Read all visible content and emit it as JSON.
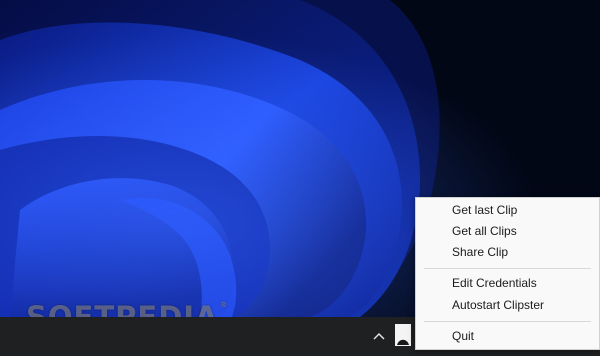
{
  "watermark": {
    "text": "SOFTPEDIA",
    "mark": "®"
  },
  "taskbar": {
    "overflow_icon": "chevron-up-icon",
    "tray_app_icon": "clipster-tray-icon"
  },
  "context_menu": {
    "items": [
      {
        "label": "Get last Clip"
      },
      {
        "label": "Get all Clips"
      },
      {
        "label": "Share Clip"
      },
      {
        "label": "Edit Credentials"
      },
      {
        "label": "Autostart Clipster"
      },
      {
        "label": "Quit"
      }
    ]
  },
  "colors": {
    "wallpaper_dark": "#020716",
    "wallpaper_blue": "#1d4ff0",
    "taskbar": "#1f2022",
    "menu_background": "#f9f9f9",
    "menu_text": "#1b1b1b"
  }
}
